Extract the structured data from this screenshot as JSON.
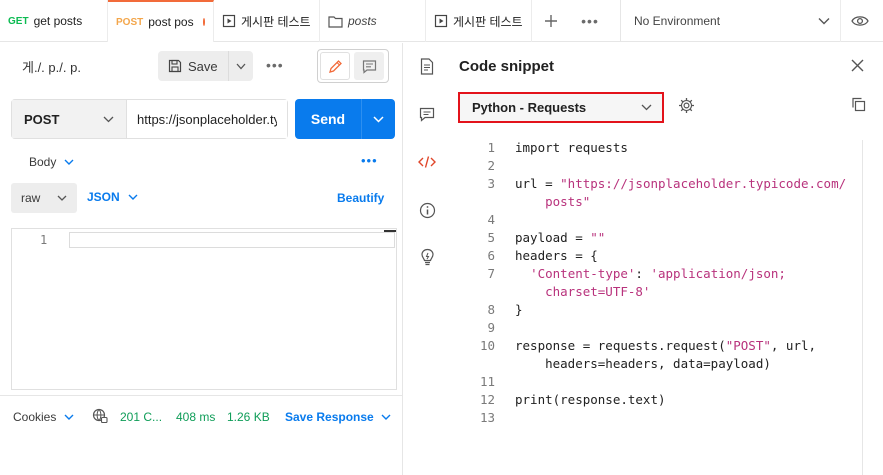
{
  "tabs": [
    {
      "method": "GET",
      "label": "get posts",
      "kind": "request"
    },
    {
      "method": "POST",
      "label": "post pos",
      "kind": "request",
      "unsaved": true
    },
    {
      "label": "게시판 테스트",
      "kind": "runner"
    },
    {
      "label": "posts",
      "kind": "folder"
    },
    {
      "label": "게시판 테스트",
      "kind": "runner"
    }
  ],
  "tabbar": {
    "environment": "No Environment"
  },
  "request": {
    "title": "게./. p./. p.",
    "save_label": "Save",
    "method": "POST",
    "url": "https://jsonplaceholder.typicode.com/posts",
    "send_label": "Send",
    "body_label": "Body",
    "body_type": "raw",
    "body_format": "JSON",
    "beautify_label": "Beautify",
    "editor_line": "1"
  },
  "response": {
    "cookies_label": "Cookies",
    "status": "201 C...",
    "time": "408 ms",
    "size": "1.26 KB",
    "save_response_label": "Save Response"
  },
  "snippet": {
    "title": "Code snippet",
    "language": "Python - Requests",
    "lines": [
      {
        "n": "1",
        "segs": [
          [
            "kw",
            "import"
          ],
          [
            "",
            " requests"
          ]
        ]
      },
      {
        "n": "2",
        "segs": []
      },
      {
        "n": "3",
        "segs": [
          [
            "",
            "url = "
          ],
          [
            "str",
            "\"https://jsonplaceholder.typicode.com/"
          ]
        ]
      },
      {
        "n": "",
        "segs": [
          [
            "str",
            "    posts\""
          ]
        ]
      },
      {
        "n": "4",
        "segs": []
      },
      {
        "n": "5",
        "segs": [
          [
            "",
            "payload = "
          ],
          [
            "str",
            "\"\""
          ]
        ]
      },
      {
        "n": "6",
        "segs": [
          [
            "",
            "headers = {"
          ]
        ]
      },
      {
        "n": "7",
        "segs": [
          [
            "",
            "  "
          ],
          [
            "str",
            "'Content-type'"
          ],
          [
            "",
            ": "
          ],
          [
            "str",
            "'application/json;"
          ]
        ]
      },
      {
        "n": "",
        "segs": [
          [
            "str",
            "    charset=UTF-8'"
          ]
        ]
      },
      {
        "n": "8",
        "segs": [
          [
            "",
            "}"
          ]
        ]
      },
      {
        "n": "9",
        "segs": []
      },
      {
        "n": "10",
        "segs": [
          [
            "",
            "response = requests.request("
          ],
          [
            "str",
            "\"POST\""
          ],
          [
            "",
            ", url,"
          ]
        ]
      },
      {
        "n": "",
        "segs": [
          [
            "",
            "    headers=headers, data=payload)"
          ]
        ]
      },
      {
        "n": "11",
        "segs": []
      },
      {
        "n": "12",
        "segs": [
          [
            "",
            "print(response.text)"
          ]
        ]
      },
      {
        "n": "13",
        "segs": []
      }
    ]
  },
  "colors": {
    "accent": "#097bed",
    "tab_active": "#f26b3a",
    "highlight_border": "#e3131b",
    "success": "#0f9d58"
  },
  "icons": [
    "add-icon",
    "more-icon",
    "chevron-down-icon",
    "eye-icon",
    "save-icon",
    "edit-icon",
    "comment-icon",
    "document-icon",
    "code-icon",
    "info-icon",
    "lightbulb-icon",
    "close-icon",
    "gear-icon",
    "copy-icon",
    "globe-icon"
  ]
}
